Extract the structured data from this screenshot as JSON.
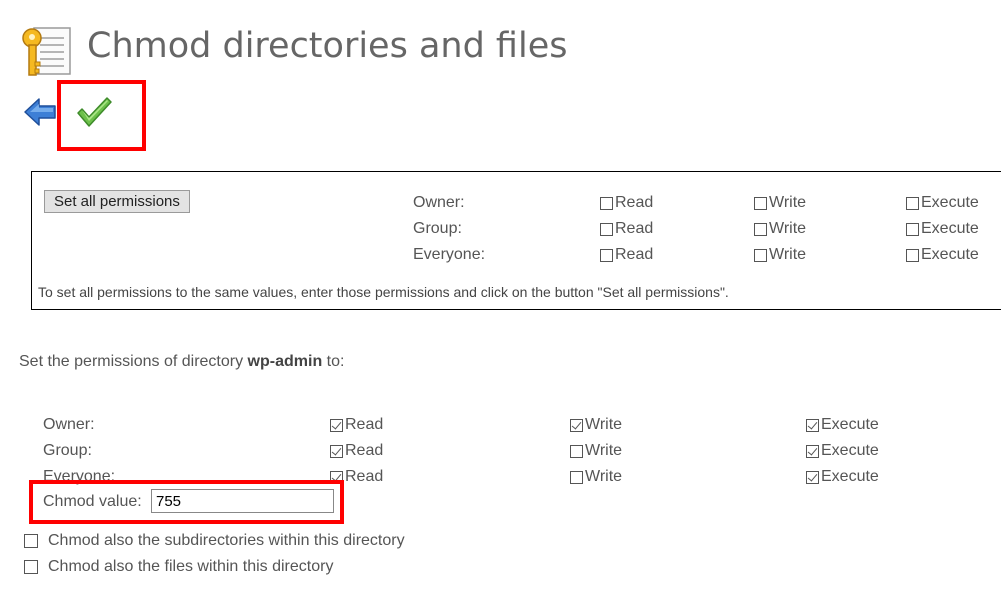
{
  "header": {
    "title": "Chmod directories and files",
    "title_icon": "key-document-icon"
  },
  "toolbar": {
    "back_icon": "back-arrow-icon",
    "submit_icon": "green-checkmark-icon"
  },
  "set_all": {
    "button_label": "Set all permissions",
    "rows": [
      {
        "label": "Owner:",
        "read": false,
        "write": false,
        "execute": false
      },
      {
        "label": "Group:",
        "read": false,
        "write": false,
        "execute": false
      },
      {
        "label": "Everyone:",
        "read": false,
        "write": false,
        "execute": false
      }
    ],
    "read_label": "Read",
    "write_label": "Write",
    "execute_label": "Execute",
    "note": "To set all permissions to the same values, enter those permissions and click on the button \"Set all permissions\"."
  },
  "directory": {
    "intro_prefix": "Set the permissions of directory",
    "name": "wp-admin",
    "intro_suffix": "to:",
    "rows": [
      {
        "label": "Owner:",
        "read": true,
        "write": true,
        "execute": true
      },
      {
        "label": "Group:",
        "read": true,
        "write": false,
        "execute": true
      },
      {
        "label": "Everyone:",
        "read": true,
        "write": false,
        "execute": true
      }
    ],
    "read_label": "Read",
    "write_label": "Write",
    "execute_label": "Execute",
    "chmod_label": "Chmod value:",
    "chmod_value": "755",
    "subdirs_label": "Chmod also the subdirectories within this directory",
    "files_label": "Chmod also the files within this directory",
    "subdirs_checked": false,
    "files_checked": false
  },
  "colors": {
    "highlight": "#ff0000",
    "checkmark": "#5cb84a",
    "back_arrow": "#3d7fd6"
  }
}
